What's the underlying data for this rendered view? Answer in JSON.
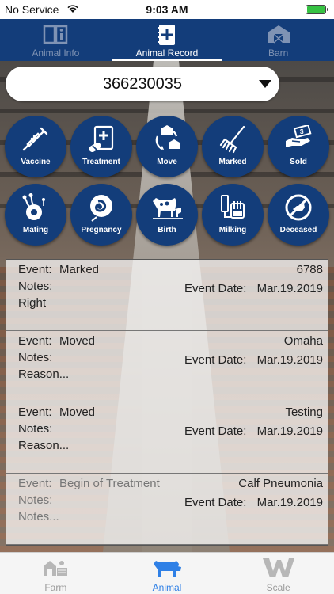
{
  "status_bar": {
    "carrier": "No Service",
    "time": "9:03 AM"
  },
  "top_tabs": [
    {
      "label": "Animal Info",
      "active": false
    },
    {
      "label": "Animal Record",
      "active": true
    },
    {
      "label": "Barn",
      "active": false
    }
  ],
  "selector": {
    "value": "366230035"
  },
  "actions": [
    {
      "label": "Vaccine",
      "icon": "syringe-icon"
    },
    {
      "label": "Treatment",
      "icon": "treatment-icon"
    },
    {
      "label": "Move",
      "icon": "move-icon"
    },
    {
      "label": "Marked",
      "icon": "marker-icon"
    },
    {
      "label": "Sold",
      "icon": "sold-icon"
    },
    {
      "label": "Mating",
      "icon": "mating-icon"
    },
    {
      "label": "Pregnancy",
      "icon": "pregnancy-icon"
    },
    {
      "label": "Birth",
      "icon": "birth-icon"
    },
    {
      "label": "Milking",
      "icon": "milking-icon"
    },
    {
      "label": "Deceased",
      "icon": "deceased-icon"
    }
  ],
  "events": [
    {
      "event_label": "Event:",
      "event": "Marked",
      "notes_label": "Notes:",
      "notes": "Right",
      "right_value": "6788",
      "date_label": "Event Date:",
      "date": "Mar.19.2019"
    },
    {
      "event_label": "Event:",
      "event": "Moved",
      "notes_label": "Notes:",
      "notes": "Reason...",
      "right_value": "Omaha",
      "date_label": "Event Date:",
      "date": "Mar.19.2019"
    },
    {
      "event_label": "Event:",
      "event": "Moved",
      "notes_label": "Notes:",
      "notes": "Reason...",
      "right_value": "Testing",
      "date_label": "Event Date:",
      "date": "Mar.19.2019"
    },
    {
      "event_label": "Event:",
      "event": "Begin of Treatment",
      "notes_label": "Notes:",
      "notes": "Notes...",
      "right_value": "Calf Pneumonia",
      "date_label": "Event Date:",
      "date": "Mar.19.2019"
    }
  ],
  "bottom_tabs": [
    {
      "label": "Farm",
      "active": false
    },
    {
      "label": "Animal",
      "active": true
    },
    {
      "label": "Scale",
      "active": false
    }
  ],
  "colors": {
    "primary": "#133d7a",
    "active_tab": "#2f80e6",
    "battery": "#36c243"
  }
}
